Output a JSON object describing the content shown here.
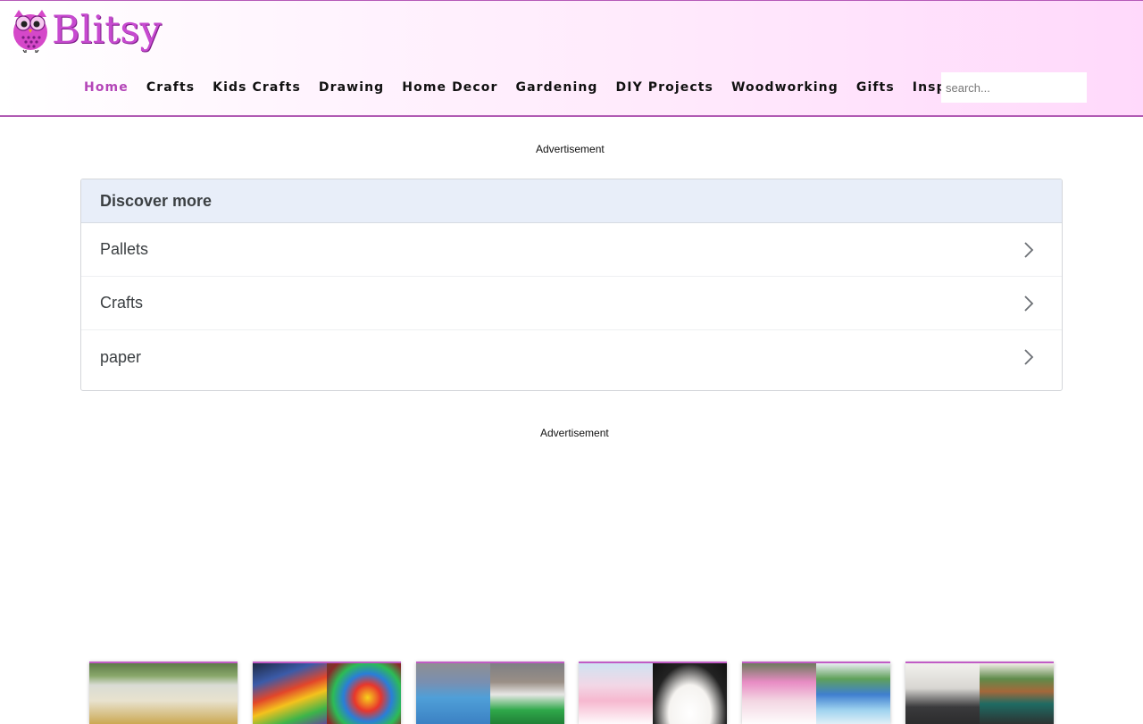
{
  "brand": {
    "name": "Blitsy"
  },
  "nav": {
    "items": [
      "Home",
      "Crafts",
      "Kids Crafts",
      "Drawing",
      "Home Decor",
      "Gardening",
      "DIY Projects",
      "Woodworking",
      "Gifts",
      "Inspirations"
    ],
    "active": "Home"
  },
  "search": {
    "placeholder": "search...",
    "value": ""
  },
  "ads": {
    "top_label": "Advertisement",
    "bottom_label": "Advertisement"
  },
  "discover": {
    "title": "Discover more",
    "items": [
      "Pallets",
      "Crafts",
      "paper"
    ]
  },
  "colors": {
    "accent": "#b446b8",
    "header_border": "#b05bb3",
    "discover_head_bg": "#e8eef9"
  },
  "thumbnails": [
    {
      "name": "thumb-craft-container"
    },
    {
      "name": "thumb-tie-dye-shoes"
    },
    {
      "name": "thumb-birthday-cake-green"
    },
    {
      "name": "thumb-unicorn-cake"
    },
    {
      "name": "thumb-pink-blue-cake"
    },
    {
      "name": "thumb-fireplace-decor"
    }
  ]
}
